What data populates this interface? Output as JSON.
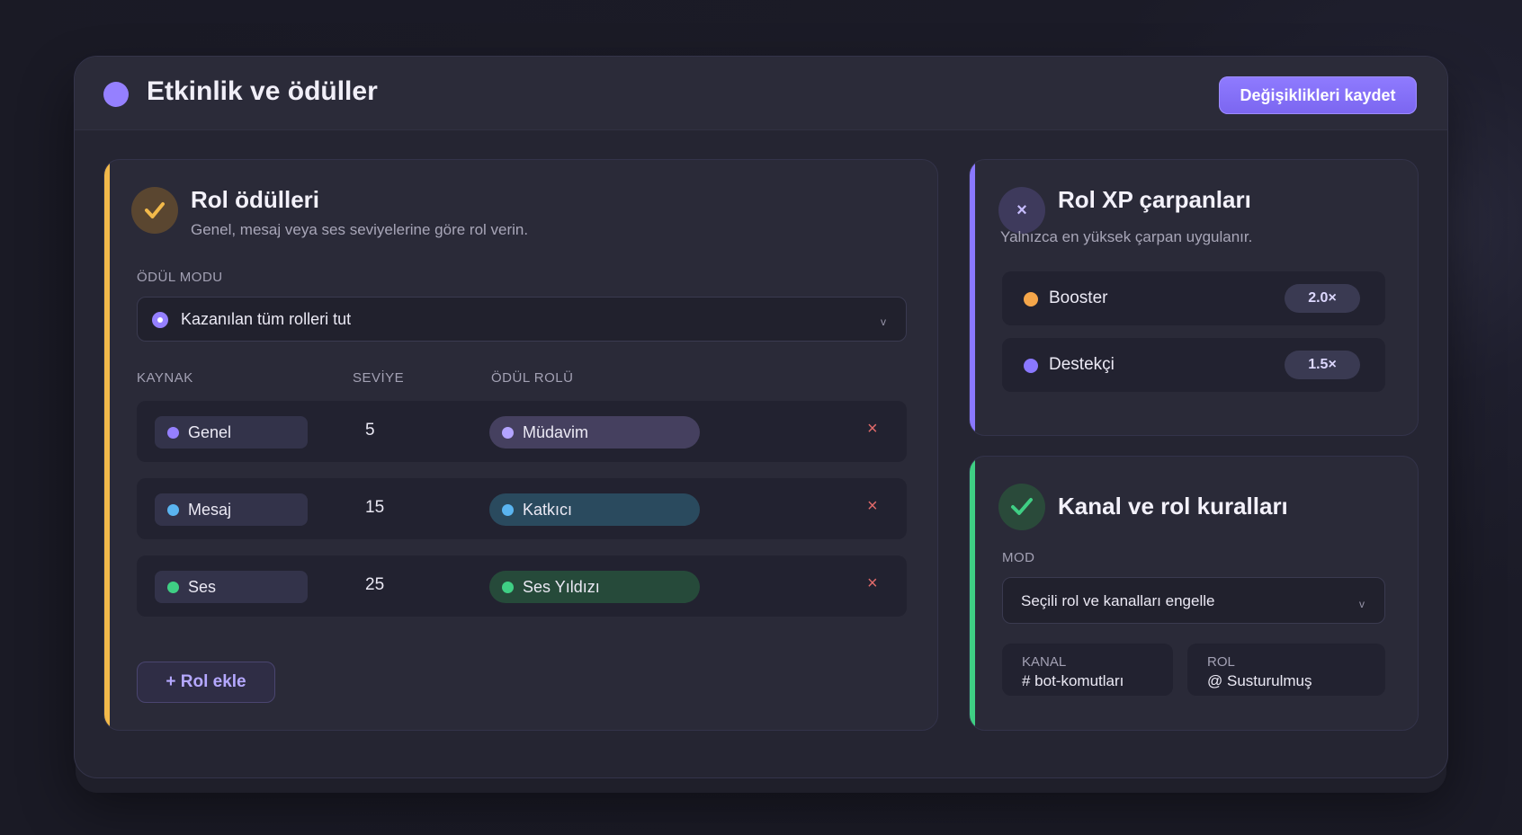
{
  "header": {
    "title": "Etkinlik ve ödüller",
    "save_label": "Değişiklikleri kaydet"
  },
  "role_rewards": {
    "title": "Rol ödülleri",
    "subtitle": "Genel, mesaj veya ses seviyelerine göre rol verin.",
    "mode_label": "ÖDÜL MODU",
    "mode_value": "Kazanılan tüm rolleri tut",
    "chevron": "v",
    "columns": {
      "source": "KAYNAK",
      "level": "SEVİYE",
      "role": "ÖDÜL ROLÜ"
    },
    "rows": [
      {
        "source": "Genel",
        "level": "5",
        "role": "Müdavim",
        "delete": "×"
      },
      {
        "source": "Mesaj",
        "level": "15",
        "role": "Katkıcı",
        "delete": "×"
      },
      {
        "source": "Ses",
        "level": "25",
        "role": "Ses Yıldızı",
        "delete": "×"
      }
    ],
    "add_label": "+ Rol ekle"
  },
  "xp_multipliers": {
    "title": "Rol XP çarpanları",
    "subtitle": "Yalnızca en yüksek çarpan uygulanır.",
    "icon_glyph": "×",
    "items": [
      {
        "name": "Booster",
        "value": "2.0×"
      },
      {
        "name": "Destekçi",
        "value": "1.5×"
      }
    ]
  },
  "channel_rules": {
    "title": "Kanal ve rol kuralları",
    "mode_label": "MOD",
    "mode_value": "Seçili rol ve kanalları engelle",
    "chevron": "v",
    "channel_label": "KANAL",
    "channel_value": "# bot-komutları",
    "role_label": "ROL",
    "role_value": "@ Susturulmuş"
  },
  "colors": {
    "accent_purple": "#9580ff",
    "accent_yellow": "#f2b94a",
    "accent_green": "#3fcf84",
    "source_genel": "#9580ff",
    "source_mesaj": "#5ab4f0",
    "source_ses": "#3fcf84",
    "booster": "#f5a64a",
    "destekci": "#8a78ff"
  }
}
